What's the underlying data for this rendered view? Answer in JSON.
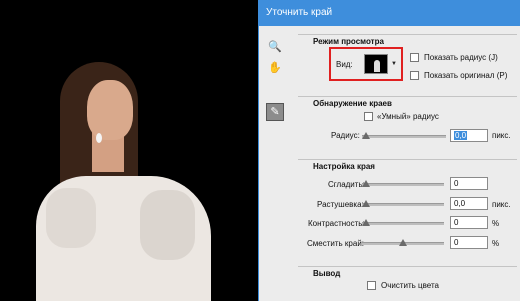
{
  "dialog": {
    "title": "Уточнить край"
  },
  "tools": {
    "zoom": "🔍",
    "hand": "✋",
    "brush": "✎"
  },
  "view_mode": {
    "title": "Режим просмотра",
    "view_label": "Вид:",
    "show_radius": "Показать радиус (J)",
    "show_original": "Показать оригинал (P)"
  },
  "edge_detection": {
    "title": "Обнаружение краев",
    "smart_radius": "«Умный» радиус",
    "radius_label": "Радиус:",
    "radius_value": "0,0",
    "radius_unit": "пикс.",
    "radius_level": 0
  },
  "edge_settings": {
    "title": "Настройка края",
    "smooth_label": "Сгладить:",
    "smooth_value": "0",
    "smooth_level": 0,
    "feather_label": "Растушевка:",
    "feather_value": "0,0",
    "feather_unit": "пикс.",
    "feather_level": 0,
    "contrast_label": "Контрастность:",
    "contrast_value": "0",
    "contrast_unit": "%",
    "contrast_level": 0,
    "shift_label": "Сместить край:",
    "shift_value": "0",
    "shift_unit": "%",
    "shift_level": 0.5
  },
  "output": {
    "title": "Вывод",
    "clear_colors": "Очистить цвета"
  },
  "colors": {
    "accent": "#3e8edc",
    "highlight": "#e02020"
  }
}
